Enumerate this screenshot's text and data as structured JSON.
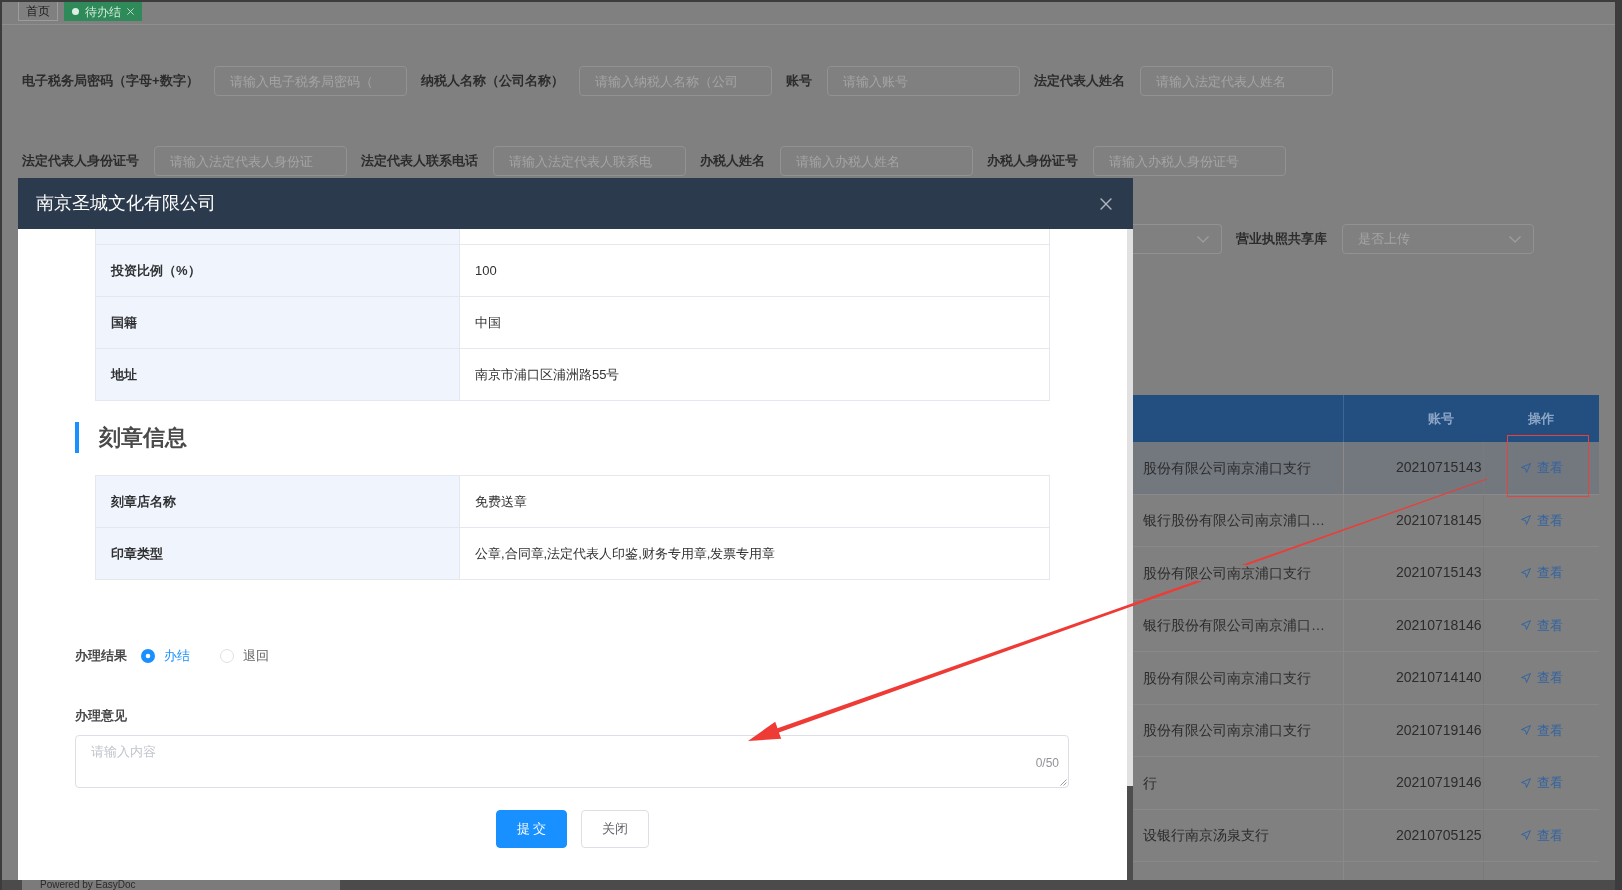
{
  "tabs": [
    {
      "label": "首页",
      "selected": false,
      "closable": false
    },
    {
      "label": "待办结",
      "selected": true,
      "closable": true
    }
  ],
  "filter_rows": [
    {
      "fields": [
        {
          "kind": "input",
          "label": "电子税务局密码（字母+数字）",
          "placeholder": "请输入电子税务局密码（"
        },
        {
          "kind": "input",
          "label": "纳税人名称（公司名称）",
          "placeholder": "请输入纳税人名称（公司"
        },
        {
          "kind": "input",
          "label": "账号",
          "placeholder": "请输入账号"
        },
        {
          "kind": "input",
          "label": "法定代表人姓名",
          "placeholder": "请输入法定代表人姓名"
        }
      ]
    },
    {
      "fields": [
        {
          "kind": "input",
          "label": "法定代表人身份证号",
          "placeholder": "请输入法定代表人身份证"
        },
        {
          "kind": "input",
          "label": "法定代表人联系电话",
          "placeholder": "请输入法定代表人联系电"
        },
        {
          "kind": "input",
          "label": "办税人姓名",
          "placeholder": "请输入办税人姓名"
        },
        {
          "kind": "input",
          "label": "办税人身份证号",
          "placeholder": "请输入办税人身份证号"
        }
      ]
    },
    {
      "fields": [
        {
          "kind": "select"
        },
        {
          "kind": "select",
          "label": "营业执照共享库",
          "placeholder": "是否上传"
        }
      ]
    }
  ],
  "table": {
    "columns": [
      {
        "label": "账号"
      },
      {
        "label": "操作"
      }
    ],
    "rows": [
      {
        "column_1": "股份有限公司南京浦口支行",
        "account": "20210715143",
        "action": "查看",
        "selected": true
      },
      {
        "column_1": "银行股份有限公司南京浦口…",
        "account": "20210718145",
        "action": "查看",
        "selected": false
      },
      {
        "column_1": "股份有限公司南京浦口支行",
        "account": "20210715143",
        "action": "查看",
        "selected": false
      },
      {
        "column_1": "银行股份有限公司南京浦口…",
        "account": "20210718146",
        "action": "查看",
        "selected": false
      },
      {
        "column_1": "股份有限公司南京浦口支行",
        "account": "20210714140",
        "action": "查看",
        "selected": false
      },
      {
        "column_1": "股份有限公司南京浦口支行",
        "account": "20210719146",
        "action": "查看",
        "selected": false
      },
      {
        "column_1": "行",
        "account": "20210719146",
        "action": "查看",
        "selected": false
      },
      {
        "column_1": "设银行南京汤泉支行",
        "account": "20210705125",
        "action": "查看",
        "selected": false
      }
    ]
  },
  "dialog": {
    "title": "南京圣城文化有限公司",
    "investor_rows": [
      {
        "label": "投资比例（%）",
        "value": "100"
      },
      {
        "label": "国籍",
        "value": "中国"
      },
      {
        "label": "地址",
        "value": "南京市浦口区浦洲路55号"
      }
    ],
    "seal_section": {
      "title": "刻章信息",
      "rows": [
        {
          "label": "刻章店名称",
          "value": "免费送章"
        },
        {
          "label": "印章类型",
          "value": "公章,合同章,法定代表人印鉴,财务专用章,发票专用章"
        }
      ]
    },
    "result": {
      "label": "办理结果",
      "options": [
        {
          "label": "办结",
          "selected": true
        },
        {
          "label": "退回",
          "selected": false
        }
      ]
    },
    "opinion": {
      "label": "办理意见",
      "placeholder": "请输入内容",
      "counter": "0/50"
    },
    "buttons": [
      {
        "label": "提 交",
        "kind": "primary"
      },
      {
        "label": "关闭",
        "kind": "default"
      }
    ]
  },
  "footer": {
    "text": "Powered by EasyDoc"
  }
}
